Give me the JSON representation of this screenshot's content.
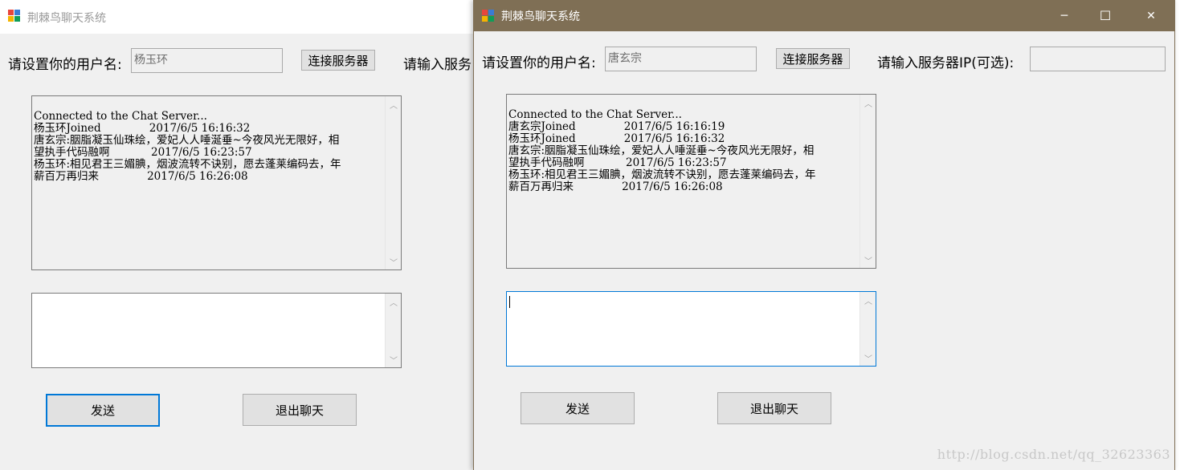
{
  "colors": {
    "active_titlebar": "#7f6f55",
    "window_bg": "#f0f0f0",
    "focus_blue": "#0078d7"
  },
  "icons": {
    "app_icon": "app-icon",
    "minimize": "minimize-icon",
    "maximize": "maximize-icon",
    "close": "close-icon",
    "scroll_up": "chevron-up-icon",
    "scroll_down": "chevron-down-icon"
  },
  "left_window": {
    "title": "荆棘鸟聊天系统",
    "username_label": "请设置你的用户名:",
    "username_value": "杨玉环",
    "connect_button": "连接服务器",
    "server_ip_label": "请输入服务",
    "log": [
      "Connected to the Chat Server...",
      "杨玉环Joined              2017/6/5 16:16:32",
      "唐玄宗:胭脂凝玉仙珠绘，爱妃人人唾涎垂~今夜风光无限好，相",
      "望执手代码融啊            2017/6/5 16:23:57",
      "杨玉环:相见君王三媚腆，烟波流转不诀别，愿去蓬莱编码去，年",
      "薪百万再归来              2017/6/5 16:26:08"
    ],
    "message_value": "",
    "send_button": "发送",
    "quit_button": "退出聊天"
  },
  "right_window": {
    "title": "荆棘鸟聊天系统",
    "username_label": "请设置你的用户名:",
    "username_value": "唐玄宗",
    "connect_button": "连接服务器",
    "server_ip_label": "请输入服务器IP(可选):",
    "server_ip_value": "",
    "log": [
      "Connected to the Chat Server...",
      "唐玄宗Joined              2017/6/5 16:16:19",
      "杨玉环Joined              2017/6/5 16:16:32",
      "唐玄宗:胭脂凝玉仙珠绘，爱妃人人唾涎垂~今夜风光无限好，相",
      "望执手代码融啊            2017/6/5 16:23:57",
      "杨玉环:相见君王三媚腆，烟波流转不诀别，愿去蓬莱编码去，年",
      "薪百万再归来              2017/6/5 16:26:08"
    ],
    "message_value": "",
    "send_button": "发送",
    "quit_button": "退出聊天",
    "minimize_glyph": "─",
    "maximize_glyph": "☐",
    "close_glyph": "✕"
  },
  "watermark": "http://blog.csdn.net/qq_32623363"
}
